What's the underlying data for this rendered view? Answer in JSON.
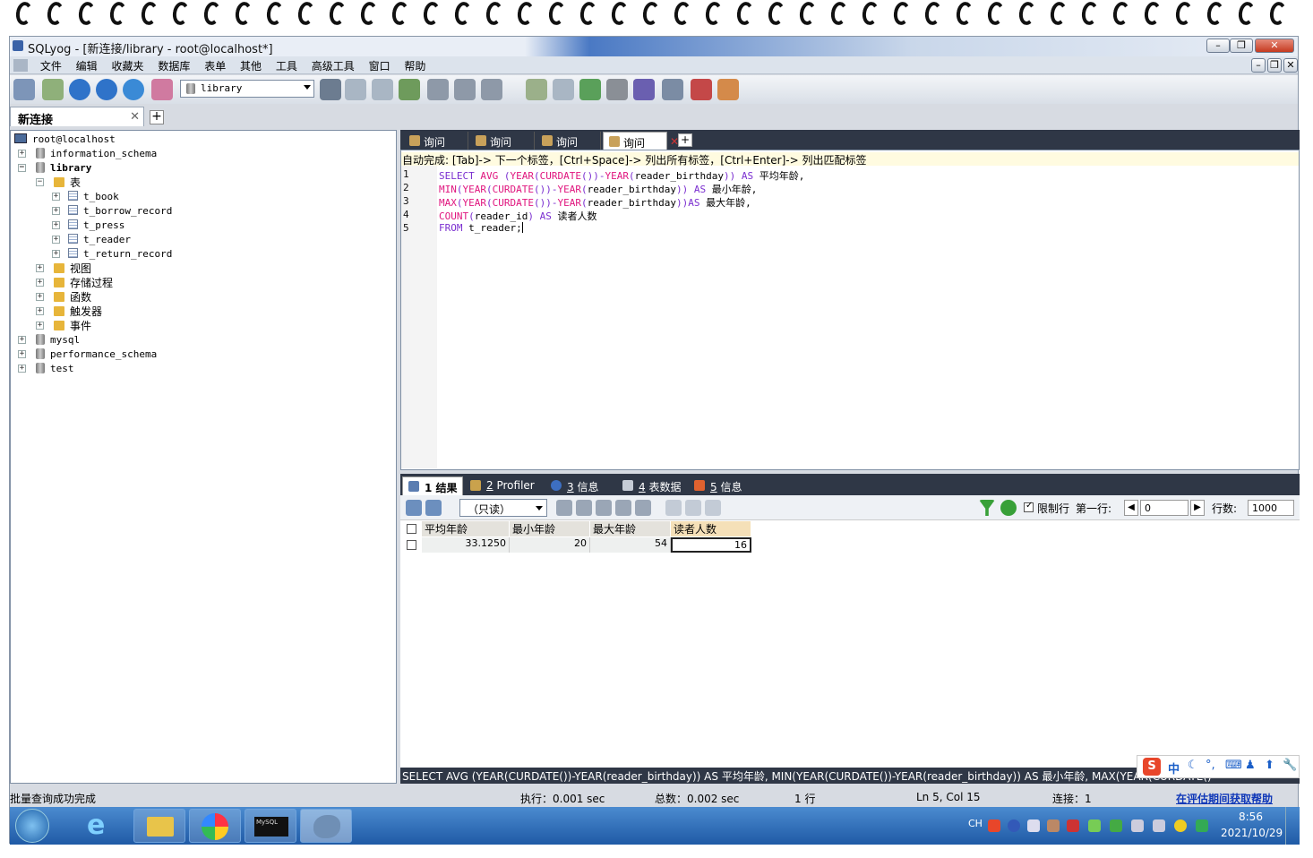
{
  "window": {
    "title": "SQLyog - [新连接/library - root@localhost*]"
  },
  "menu": [
    "文件",
    "编辑",
    "收藏夹",
    "数据库",
    "表单",
    "其他",
    "工具",
    "高级工具",
    "窗口",
    "帮助"
  ],
  "toolbar": {
    "db_selected": "library"
  },
  "connection_tab": {
    "label": "新连接"
  },
  "tree": {
    "host": "root@localhost",
    "databases": [
      "information_schema",
      "library"
    ],
    "library_folder_tables": "表",
    "tables": [
      "t_book",
      "t_borrow_record",
      "t_press",
      "t_reader",
      "t_return_record"
    ],
    "folders": [
      "视图",
      "存储过程",
      "函数",
      "触发器",
      "事件"
    ],
    "other_dbs": [
      "mysql",
      "performance_schema",
      "test"
    ]
  },
  "query_tabs": [
    "询问",
    "询问",
    "询问",
    "询问"
  ],
  "editor": {
    "autocomplete_hint": "自动完成: [Tab]-> 下一个标签，[Ctrl+Space]-> 列出所有标签，[Ctrl+Enter]-> 列出匹配标签",
    "line_numbers": [
      "1",
      "2",
      "3",
      "4",
      "5"
    ],
    "lines": [
      "SELECT AVG (YEAR(CURDATE())-YEAR(reader_birthday)) AS 平均年龄,",
      "MIN(YEAR(CURDATE())-YEAR(reader_birthday)) AS 最小年龄,",
      "MAX(YEAR(CURDATE())-YEAR(reader_birthday))AS 最大年龄,",
      "COUNT(reader_id) AS 读者人数",
      "FROM t_reader;"
    ]
  },
  "result_tabs": [
    {
      "num": "1",
      "label": "结果"
    },
    {
      "num": "2",
      "label": "Profiler"
    },
    {
      "num": "3",
      "label": "信息"
    },
    {
      "num": "4",
      "label": "表数据"
    },
    {
      "num": "5",
      "label": "信息"
    }
  ],
  "result_toolbar": {
    "mode": "（只读）",
    "limit_label": "限制行",
    "first_row_label": "第一行:",
    "first_row": "0",
    "rows_label": "行数:",
    "rows": "1000"
  },
  "grid": {
    "columns": [
      "平均年龄",
      "最小年龄",
      "最大年龄",
      "读者人数"
    ],
    "rows": [
      [
        "33.1250",
        "20",
        "54",
        "16"
      ]
    ]
  },
  "sql_preview": "SELECT AVG (YEAR(CURDATE())-YEAR(reader_birthday)) AS 平均年龄, MIN(YEAR(CURDATE())-YEAR(reader_birthday)) AS 最小年龄, MAX(YEAR(CURDATE()",
  "status": {
    "message": "批量查询成功完成",
    "exec": "执行：0.001 sec",
    "total": "总数：0.002 sec",
    "rows": "1 行",
    "position": "Ln 5, Col 15",
    "connections": "连接：1",
    "help_link": "在评估期间获取帮助"
  },
  "ime": {
    "lang": "中"
  },
  "taskbar": {
    "lang": "CH",
    "time": "8:56",
    "date": "2021/10/29",
    "app_term_label": "MySQL"
  }
}
